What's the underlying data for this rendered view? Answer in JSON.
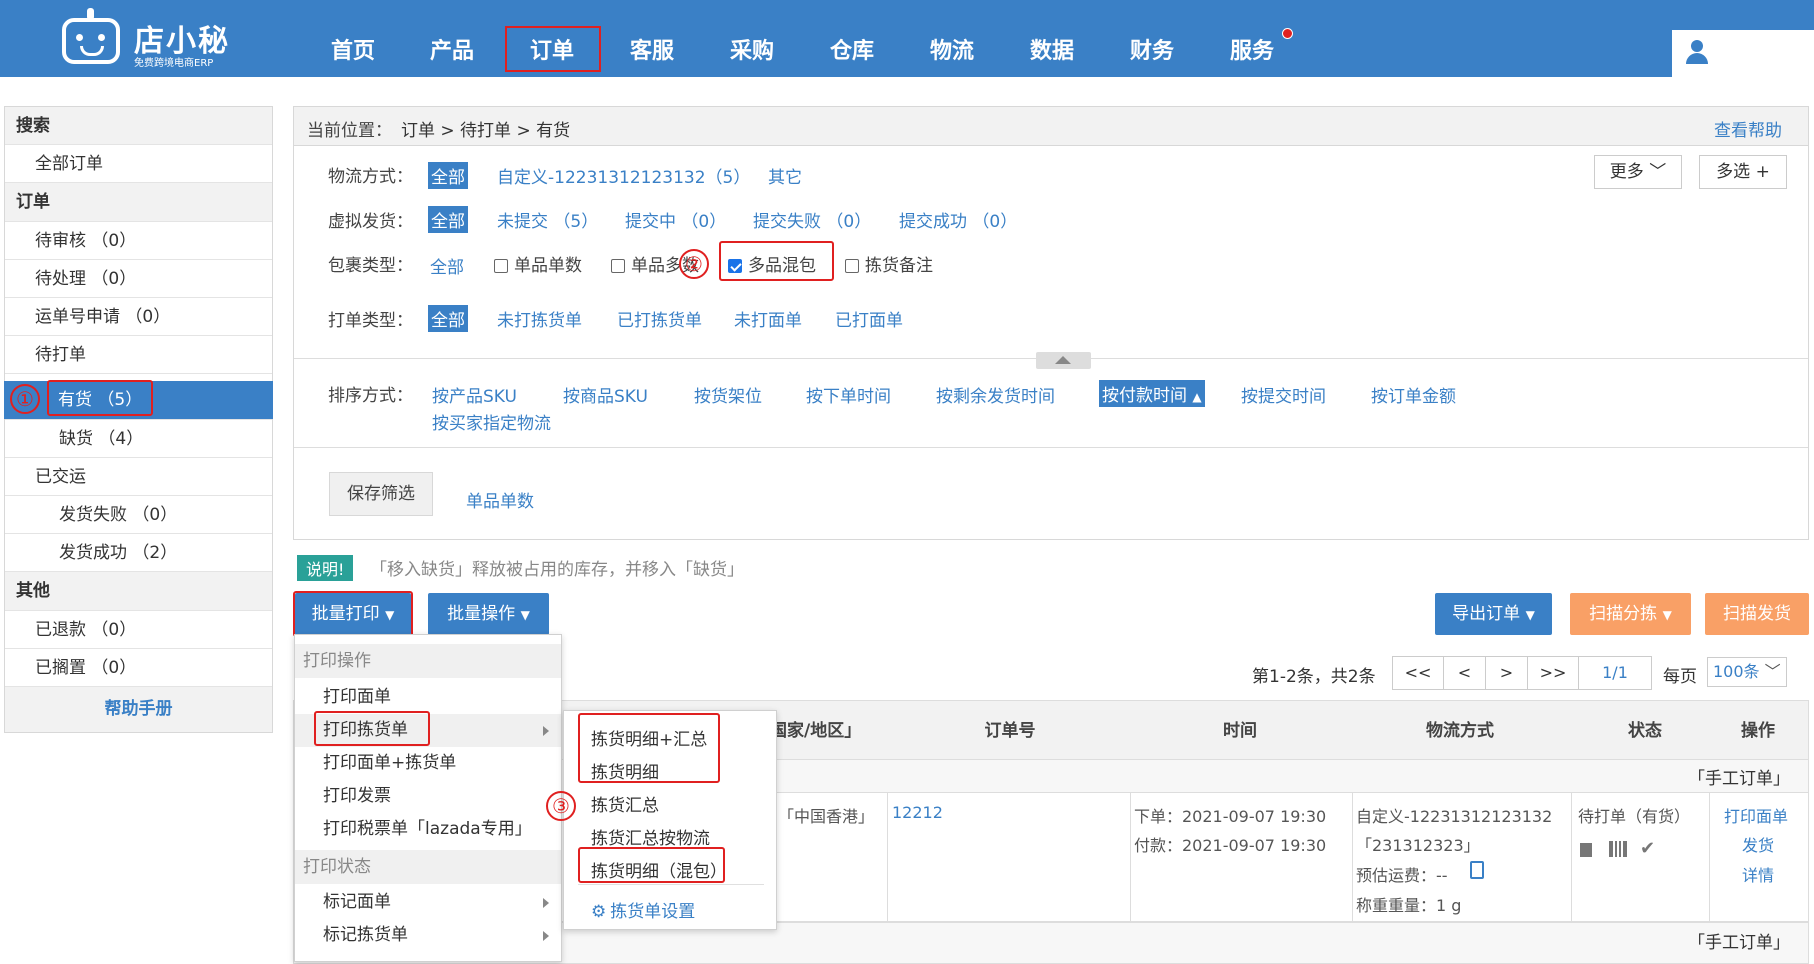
{
  "logo": {
    "name": "店小秘",
    "sub": "免费跨境电商ERP"
  },
  "nav": [
    "首页",
    "产品",
    "订单",
    "客服",
    "采购",
    "仓库",
    "物流",
    "数据",
    "财务",
    "服务"
  ],
  "sidebar": {
    "search_head": "搜索",
    "all_orders": "全部订单",
    "orders_head": "订单",
    "pending_review": "待审核 （0）",
    "pending_process": "待处理 （0）",
    "waybill_apply": "运单号申请 （0）",
    "pending_print": "待打单",
    "in_stock": "有货 （5）",
    "out_stock": "缺货 （4）",
    "shipped": "已交运",
    "ship_failed": "发货失败 （0）",
    "ship_success": "发货成功 （2）",
    "other_head": "其他",
    "refunded": "已退款 （0）",
    "shelved": "已搁置 （0）",
    "help": "帮助手册"
  },
  "crumb": {
    "prefix": "当前位置：",
    "path": "订单 > 待打单 > 有货",
    "help": "查看帮助"
  },
  "filters": {
    "logistics_label": "物流方式：",
    "logistics_all": "全部",
    "logistics_custom": "自定义-12231312123132（5）",
    "logistics_other": "其它",
    "more": "更多",
    "multi": "多选 +",
    "virtual_label": "虚拟发货：",
    "virtual_all": "全部",
    "virtual_unsubmitted": "未提交 （5）",
    "virtual_submitting": "提交中 （0）",
    "virtual_failed": "提交失败 （0）",
    "virtual_success": "提交成功 （0）",
    "package_label": "包裹类型：",
    "package_all": "全部",
    "package_single": "单品单数",
    "package_multi_qty": "单品多数",
    "package_mixed": "多品混包",
    "package_note": "拣货备注",
    "print_label": "打单类型：",
    "print_all": "全部",
    "print_unpicked": "未打拣货单",
    "print_picked": "已打拣货单",
    "print_unlabel": "未打面单",
    "print_label_done": "已打面单",
    "sort_label": "排序方式：",
    "sort_options": [
      "按产品SKU",
      "按商品SKU",
      "按货架位",
      "按下单时间",
      "按剩余发货时间"
    ],
    "sort_active": "按付款时间",
    "sort_more": [
      "按提交时间",
      "按订单金额"
    ],
    "sort_buyer": "按买家指定物流",
    "save_filter": "保存筛选",
    "saved_filter": "单品单数"
  },
  "notice": {
    "tag": "说明!",
    "text": "「移入缺货」释放被占用的库存，并移入「缺货」"
  },
  "toolbar": {
    "batch_print": "批量打印",
    "batch_ops": "批量操作",
    "export": "导出订单",
    "scan_sort": "扫描分拣",
    "scan_ship": "扫描发货"
  },
  "pager": {
    "summary": "第1-2条，共2条",
    "first": "<<",
    "prev": "<",
    "next": ">",
    "last": ">>",
    "page": "1/1",
    "per_page_label": "每页",
    "per_page": "100条"
  },
  "table": {
    "headers": [
      "国家/地区」",
      "订单号",
      "时间",
      "物流方式",
      "状态",
      "操作"
    ],
    "group_label": "「手工订单」",
    "row": {
      "country": "「中国香港」",
      "order_no": "12212",
      "order_time": "下单：2021-09-07 19:30",
      "pay_time": "付款：2021-09-07 19:30",
      "logistics": "自定义-12231312123132",
      "tracking": "「231312323」",
      "est_fee": "预估运费：--",
      "weight": "称重重量：1 g",
      "status": "待打单（有货）",
      "ops": [
        "打印面单",
        "发货",
        "详情"
      ]
    },
    "group_label_2": "「手工订单」"
  },
  "print_menu": {
    "head_ops": "打印操作",
    "items": [
      "打印面单",
      "打印拣货单",
      "打印面单+拣货单",
      "打印发票",
      "打印税票单「lazada专用」"
    ],
    "head_status": "打印状态",
    "status_items": [
      "标记面单",
      "标记拣货单"
    ]
  },
  "pick_submenu": {
    "items": [
      "拣货明细+汇总",
      "拣货明细",
      "拣货汇总",
      "拣货汇总按物流",
      "拣货明细（混包）"
    ],
    "settings": "拣货单设置"
  },
  "markers": [
    "①",
    "②",
    "③"
  ],
  "colors": {
    "primary": "#3a80c6",
    "orange": "#f9a066",
    "highlight": "#e02020",
    "notice": "#2aa198"
  }
}
